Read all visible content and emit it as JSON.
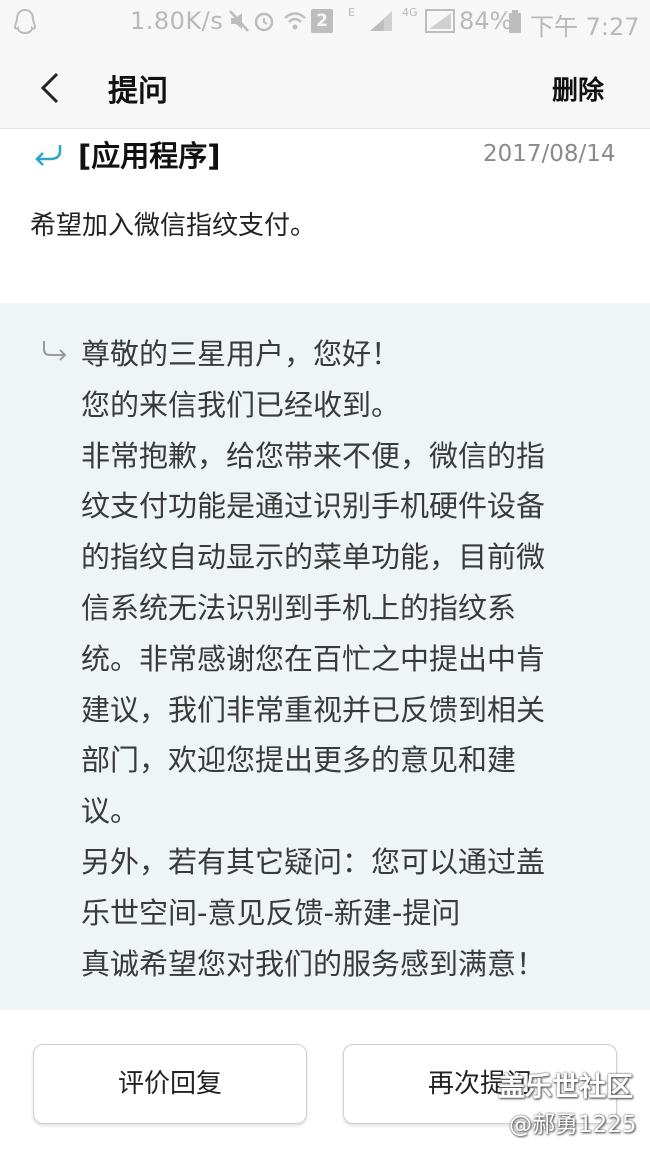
{
  "status_bar": {
    "network_speed": "1.80K/s",
    "sim_badge": "2",
    "net_letter": "E",
    "lte_label": "4G",
    "battery_percent": "84%",
    "clock": "下午 7:27"
  },
  "app_bar": {
    "title": "提问",
    "delete_label": "删除"
  },
  "question": {
    "category": "[应用程序]",
    "date": "2017/08/14",
    "text": "希望加入微信指纹支付。"
  },
  "reply": {
    "lines": [
      "尊敬的三星用户，您好！",
      "您的来信我们已经收到。",
      "非常抱歉，给您带来不便，微信的指",
      "纹支付功能是通过识别手机硬件设备",
      "的指纹自动显示的菜单功能，目前微",
      "信系统无法识别到手机上的指纹系",
      "统。非常感谢您在百忙之中提出中肯",
      "建议，我们非常重视并已反馈到相关",
      "部门，欢迎您提出更多的意见和建",
      "议。",
      "另外，若有其它疑问：您可以通过盖",
      "乐世空间-意见反馈-新建-提问",
      "真诚希望您对我们的服务感到满意！"
    ]
  },
  "buttons": {
    "rate_label": "评价回复",
    "again_label": "再次提问"
  },
  "watermark": {
    "logo_text": "盖乐世社区",
    "user_text": "@郝勇1225"
  },
  "colors": {
    "reply_background": "#eff5f7",
    "accent_arrow": "#2aa6c6"
  }
}
